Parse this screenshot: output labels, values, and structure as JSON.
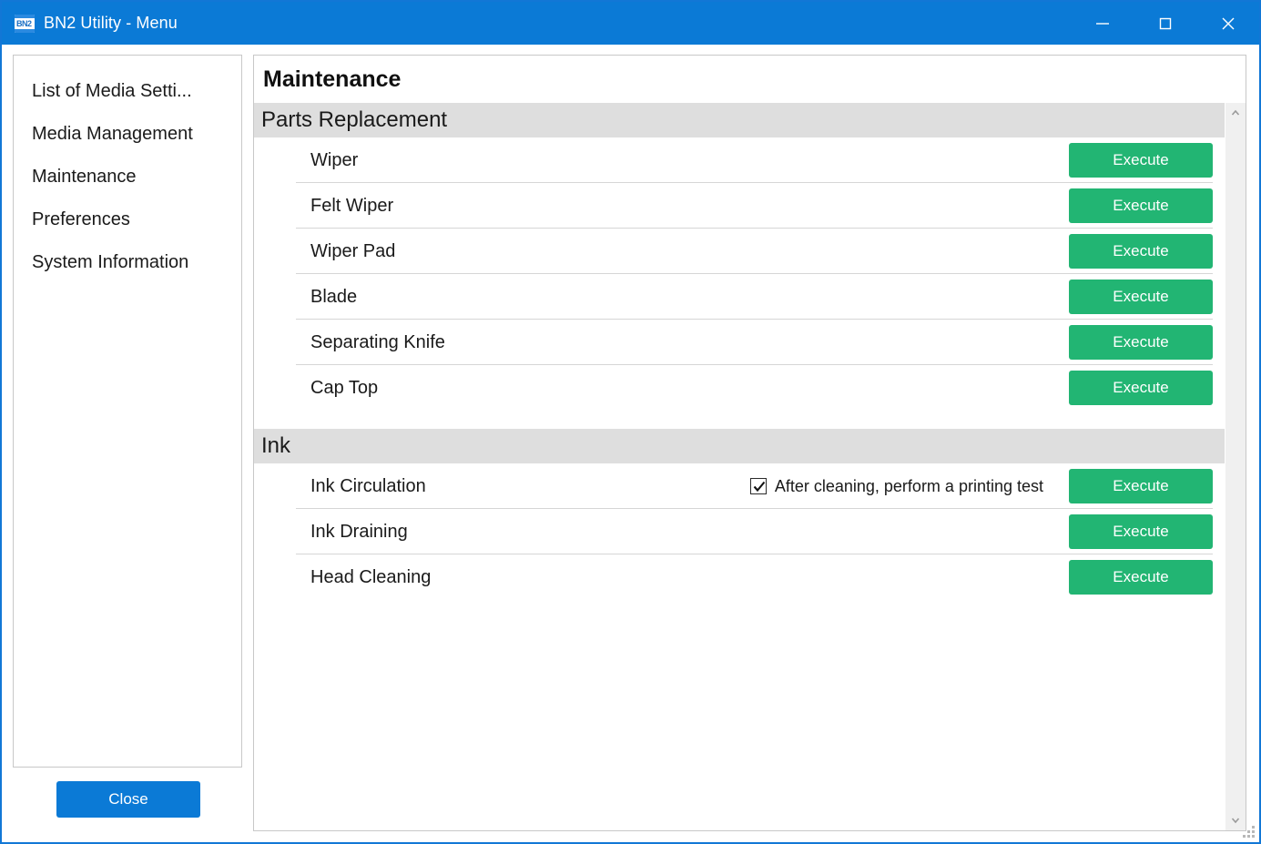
{
  "window": {
    "title": "BN2 Utility - Menu",
    "icon": "app-logo-icon",
    "controls": {
      "minimize": "minimize-icon",
      "maximize": "maximize-icon",
      "close": "close-icon"
    },
    "accent_color": "#0b7ad6",
    "border_color": "#1277d6"
  },
  "sidebar": {
    "items": [
      {
        "label": "List of Media Setti..."
      },
      {
        "label": "Media Management"
      },
      {
        "label": "Maintenance"
      },
      {
        "label": "Preferences"
      },
      {
        "label": "System Information"
      }
    ],
    "close_button": "Close"
  },
  "main": {
    "title": "Maintenance",
    "groups": [
      {
        "header": "Parts Replacement",
        "rows": [
          {
            "label": "Wiper",
            "button": "Execute"
          },
          {
            "label": "Felt Wiper",
            "button": "Execute"
          },
          {
            "label": "Wiper Pad",
            "button": "Execute"
          },
          {
            "label": "Blade",
            "button": "Execute"
          },
          {
            "label": "Separating Knife",
            "button": "Execute"
          },
          {
            "label": "Cap Top",
            "button": "Execute"
          }
        ]
      },
      {
        "header": "Ink",
        "rows": [
          {
            "label": "Ink Circulation",
            "button": "Execute",
            "checkbox": {
              "label": "After cleaning, perform a printing test",
              "checked": true
            }
          },
          {
            "label": "Ink Draining",
            "button": "Execute"
          },
          {
            "label": "Head Cleaning",
            "button": "Execute"
          }
        ]
      }
    ],
    "execute_color": "#22b573",
    "group_header_color": "#dedede"
  },
  "scrollbar": {
    "up": "chevron-up-icon",
    "down": "chevron-down-icon"
  }
}
